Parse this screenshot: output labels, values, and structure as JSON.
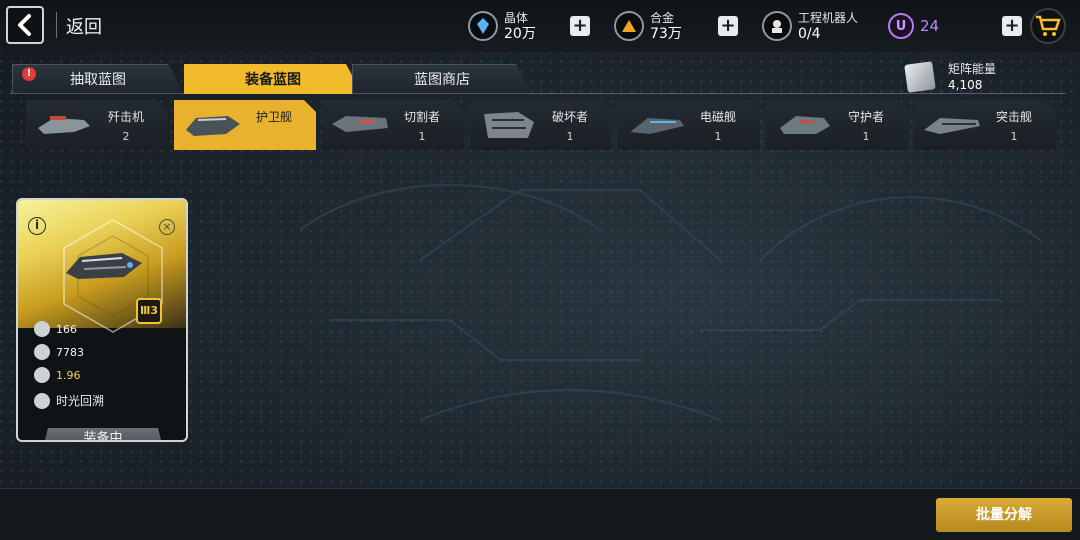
{
  "header": {
    "back_label": "返回",
    "resources": [
      {
        "name": "晶体",
        "value": "20万",
        "icon": "crystal-icon",
        "color": "#56b6f2"
      },
      {
        "name": "合金",
        "value": "73万",
        "icon": "alloy-icon",
        "color": "#f0a526"
      },
      {
        "name": "工程机器人",
        "value": "0/4",
        "icon": "robot-icon",
        "color": "#e6e6e6"
      }
    ],
    "premium": {
      "symbol": "U",
      "value": "24",
      "color": "#bf86ff"
    }
  },
  "tabs": [
    {
      "label": "抽取蓝图",
      "alert": "!"
    },
    {
      "label": "装备蓝图",
      "active": true
    },
    {
      "label": "蓝图商店"
    }
  ],
  "matrix": {
    "name": "矩阵能量",
    "value": "4,108"
  },
  "ship_classes": [
    {
      "name": "歼击机",
      "count": "2"
    },
    {
      "name": "护卫舰",
      "count": "",
      "active": true
    },
    {
      "name": "切割者",
      "count": "1"
    },
    {
      "name": "破坏者",
      "count": "1"
    },
    {
      "name": "电磁舰",
      "count": "1"
    },
    {
      "name": "守护者",
      "count": "1"
    },
    {
      "name": "突击舰",
      "count": "1"
    }
  ],
  "card": {
    "info_symbol": "i",
    "close_symbol": "×",
    "rank": "Ⅲ3",
    "stats": [
      {
        "icon": "attack-icon",
        "value": "166"
      },
      {
        "icon": "armor-icon",
        "value": "7783"
      },
      {
        "icon": "speed-icon",
        "value": "1.96",
        "highlight": true
      }
    ],
    "skill": "时光回溯",
    "equip_label": "装备中"
  },
  "actions": {
    "bulk_decompose": "批量分解"
  },
  "colors": {
    "accent": "#f2bb2c",
    "tab_bg": "#2c353c"
  }
}
